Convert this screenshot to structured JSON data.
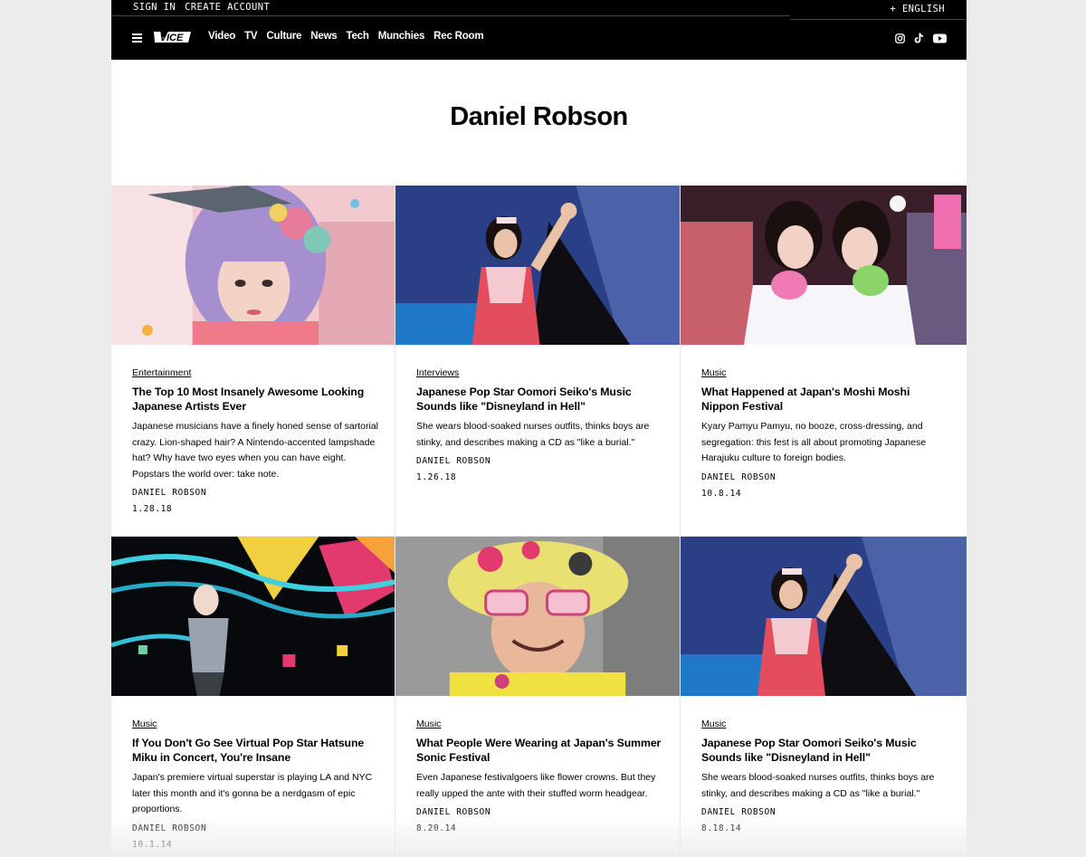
{
  "utility": {
    "sign_in": "SIGN IN",
    "create_account": "CREATE ACCOUNT",
    "language": "+ ENGLISH"
  },
  "nav": {
    "logo": "VICE",
    "links": [
      "Video",
      "TV",
      "Culture",
      "News",
      "Tech",
      "Munchies",
      "Rec Room"
    ],
    "social_icons": [
      "instagram-icon",
      "tiktok-icon",
      "youtube-icon"
    ]
  },
  "page_title": "Daniel Robson",
  "articles": [
    {
      "category": "Entertainment",
      "headline": "The Top 10 Most Insanely Awesome Looking Japanese Artists Ever",
      "dek": "Japanese musicians have a finely honed sense of sartorial crazy. Lion-shaped hair? A Nintendo-accented lampshade hat? Why have two eyes when you can have eight. Popstars the world over: take note.",
      "byline": "DANIEL ROBSON",
      "date": "1.28.18"
    },
    {
      "category": "Interviews",
      "headline": "Japanese Pop Star Oomori Seiko's Music Sounds like \"Disneyland in Hell\"",
      "dek": "She wears blood-soaked nurses outfits, thinks boys are stinky, and describes making a CD as \"like a burial.\"",
      "byline": "DANIEL ROBSON",
      "date": "1.26.18"
    },
    {
      "category": "Music",
      "headline": "What Happened at Japan's Moshi Moshi Nippon Festival",
      "dek": "Kyary Pamyu Pamyu, no booze, cross-dressing, and segregation: this fest is all about promoting Japanese Harajuku culture to foreign bodies.",
      "byline": "DANIEL ROBSON",
      "date": "10.8.14"
    },
    {
      "category": "Music",
      "headline": "If You Don't Go See Virtual Pop Star Hatsune Miku in Concert, You're Insane",
      "dek": "Japan's premiere virtual superstar is playing LA and NYC later this month and it's gonna be a nerdgasm of epic proportions.",
      "byline": "DANIEL ROBSON",
      "date": "10.1.14"
    },
    {
      "category": "Music",
      "headline": "What People Were Wearing at Japan's Summer Sonic Festival",
      "dek": "Even Japanese festivalgoers like flower crowns. But they really upped the ante with their stuffed worm headgear.",
      "byline": "DANIEL ROBSON",
      "date": "8.20.14"
    },
    {
      "category": "Music",
      "headline": "Japanese Pop Star Oomori Seiko's Music Sounds like \"Disneyland in Hell\"",
      "dek": "She wears blood-soaked nurses outfits, thinks boys are stinky, and describes making a CD as \"like a burial.\"",
      "byline": "DANIEL ROBSON",
      "date": "8.18.14"
    }
  ],
  "colors": {
    "bar": "#000000",
    "page": "#ffffff",
    "backdrop": "#ececec"
  }
}
